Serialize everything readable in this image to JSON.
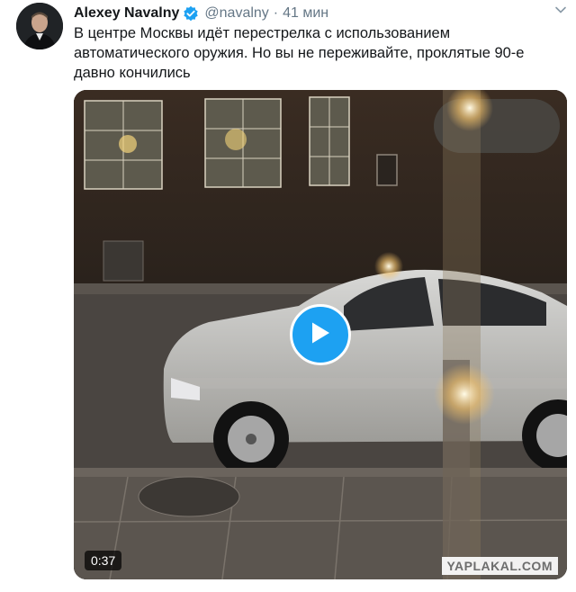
{
  "tweet": {
    "author_name": "Alexey Navalny",
    "handle": "@navalny",
    "separator": "·",
    "time": "41 мин",
    "text_lines": [
      "В центре Москвы идёт перестрелка с использованием",
      "автоматического оружия. Но вы не переживайте, проклятые 90-е",
      "давно кончились"
    ]
  },
  "video": {
    "duration": "0:37"
  },
  "watermark": {
    "text": "YAPLAKAL.COM"
  },
  "icons": {
    "verified": "verified-badge-icon",
    "menu": "chevron-down-icon",
    "play": "play-icon"
  },
  "colors": {
    "accent": "#1da1f2",
    "text_primary": "#14171a",
    "text_secondary": "#657786"
  }
}
